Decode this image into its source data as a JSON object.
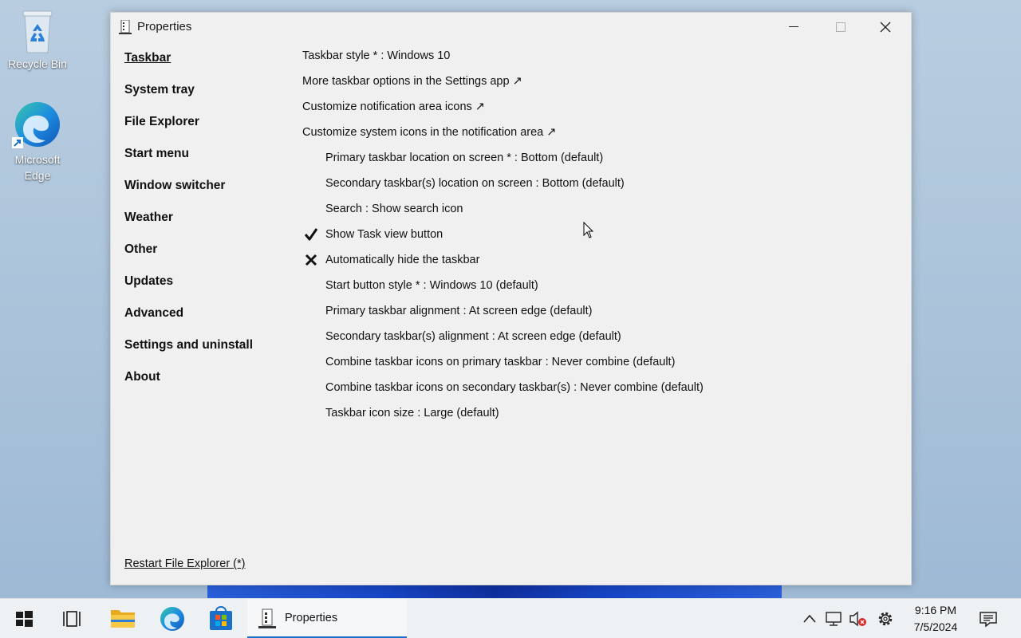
{
  "desktop": {
    "icons": [
      {
        "label": "Recycle Bin"
      },
      {
        "label": "Microsoft Edge"
      }
    ]
  },
  "window": {
    "title": "Properties",
    "nav": [
      {
        "label": "Taskbar",
        "active": true
      },
      {
        "label": "System tray"
      },
      {
        "label": "File Explorer"
      },
      {
        "label": "Start menu"
      },
      {
        "label": "Window switcher"
      },
      {
        "label": "Weather"
      },
      {
        "label": "Other"
      },
      {
        "label": "Updates"
      },
      {
        "label": "Advanced"
      },
      {
        "label": "Settings and uninstall"
      },
      {
        "label": "About"
      }
    ],
    "restart_label": "Restart File Explorer (*)",
    "options": [
      {
        "label": "Taskbar style * : Windows 10",
        "indent": false,
        "mark": "none"
      },
      {
        "label": "More taskbar options in the Settings app ↗",
        "indent": false,
        "mark": "none"
      },
      {
        "label": "Customize notification area icons ↗",
        "indent": false,
        "mark": "none"
      },
      {
        "label": "Customize system icons in the notification area ↗",
        "indent": false,
        "mark": "none"
      },
      {
        "label": "Primary taskbar location on screen * : Bottom (default)",
        "indent": true,
        "mark": "none"
      },
      {
        "label": "Secondary taskbar(s) location on screen : Bottom (default)",
        "indent": true,
        "mark": "none"
      },
      {
        "label": "Search : Show search icon",
        "indent": true,
        "mark": "none"
      },
      {
        "label": "Show Task view button",
        "indent": true,
        "mark": "check"
      },
      {
        "label": "Automatically hide the taskbar",
        "indent": true,
        "mark": "cross"
      },
      {
        "label": "Start button style * : Windows 10 (default)",
        "indent": true,
        "mark": "none"
      },
      {
        "label": "Primary taskbar alignment : At screen edge (default)",
        "indent": true,
        "mark": "none"
      },
      {
        "label": "Secondary taskbar(s) alignment : At screen edge (default)",
        "indent": true,
        "mark": "none"
      },
      {
        "label": "Combine taskbar icons on primary taskbar : Never combine (default)",
        "indent": true,
        "mark": "none"
      },
      {
        "label": "Combine taskbar icons on secondary taskbar(s) : Never combine (default)",
        "indent": true,
        "mark": "none"
      },
      {
        "label": "Taskbar icon size : Large (default)",
        "indent": true,
        "mark": "none"
      }
    ]
  },
  "taskbar": {
    "running_app_label": "Properties",
    "clock_time": "9:16 PM",
    "clock_date": "7/5/2024",
    "accent": "#1a6fc8"
  }
}
